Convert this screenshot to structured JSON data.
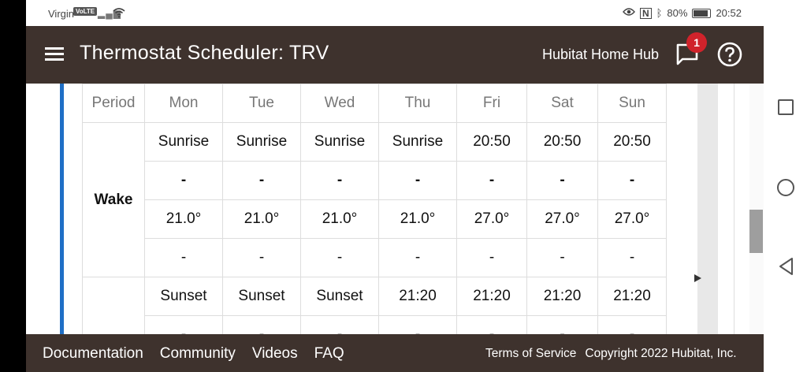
{
  "status_bar": {
    "carrier": "Virgin",
    "volte": "VoLTE",
    "battery": "80%",
    "time": "20:52"
  },
  "appbar": {
    "title": "Thermostat Scheduler: TRV",
    "hub_name": "Hubitat Home Hub",
    "notification_count": "1"
  },
  "schedule": {
    "header_period": "Period",
    "days": [
      "Mon",
      "Tue",
      "Wed",
      "Thu",
      "Fri",
      "Sat",
      "Sun"
    ],
    "wake_label": "Wake",
    "wake_times": [
      "Sunrise",
      "Sunrise",
      "Sunrise",
      "Sunrise",
      "20:50",
      "20:50",
      "20:50"
    ],
    "wake_cool": [
      "-",
      "-",
      "-",
      "-",
      "-",
      "-",
      "-"
    ],
    "wake_heat": [
      "21.0°",
      "21.0°",
      "21.0°",
      "21.0°",
      "27.0°",
      "27.0°",
      "27.0°"
    ],
    "wake_fan": [
      "-",
      "-",
      "-",
      "-",
      "-",
      "-",
      "-"
    ],
    "next_times": [
      "Sunset",
      "Sunset",
      "Sunset",
      "21:20",
      "21:20",
      "21:20",
      "21:20"
    ],
    "next_cool": [
      "-",
      "-",
      "-",
      "-",
      "-",
      "-",
      "-"
    ]
  },
  "footer": {
    "links": [
      "Documentation",
      "Community",
      "Videos",
      "FAQ"
    ],
    "terms": "Terms of Service",
    "copyright": "Copyright 2022 Hubitat, Inc."
  },
  "colors": {
    "appbar": "#3e322d",
    "accent": "#1f6fc6",
    "heat": "#c41a1a",
    "cool": "#1d2fae",
    "fan": "#1c6f1c",
    "badge": "#d0232b"
  }
}
